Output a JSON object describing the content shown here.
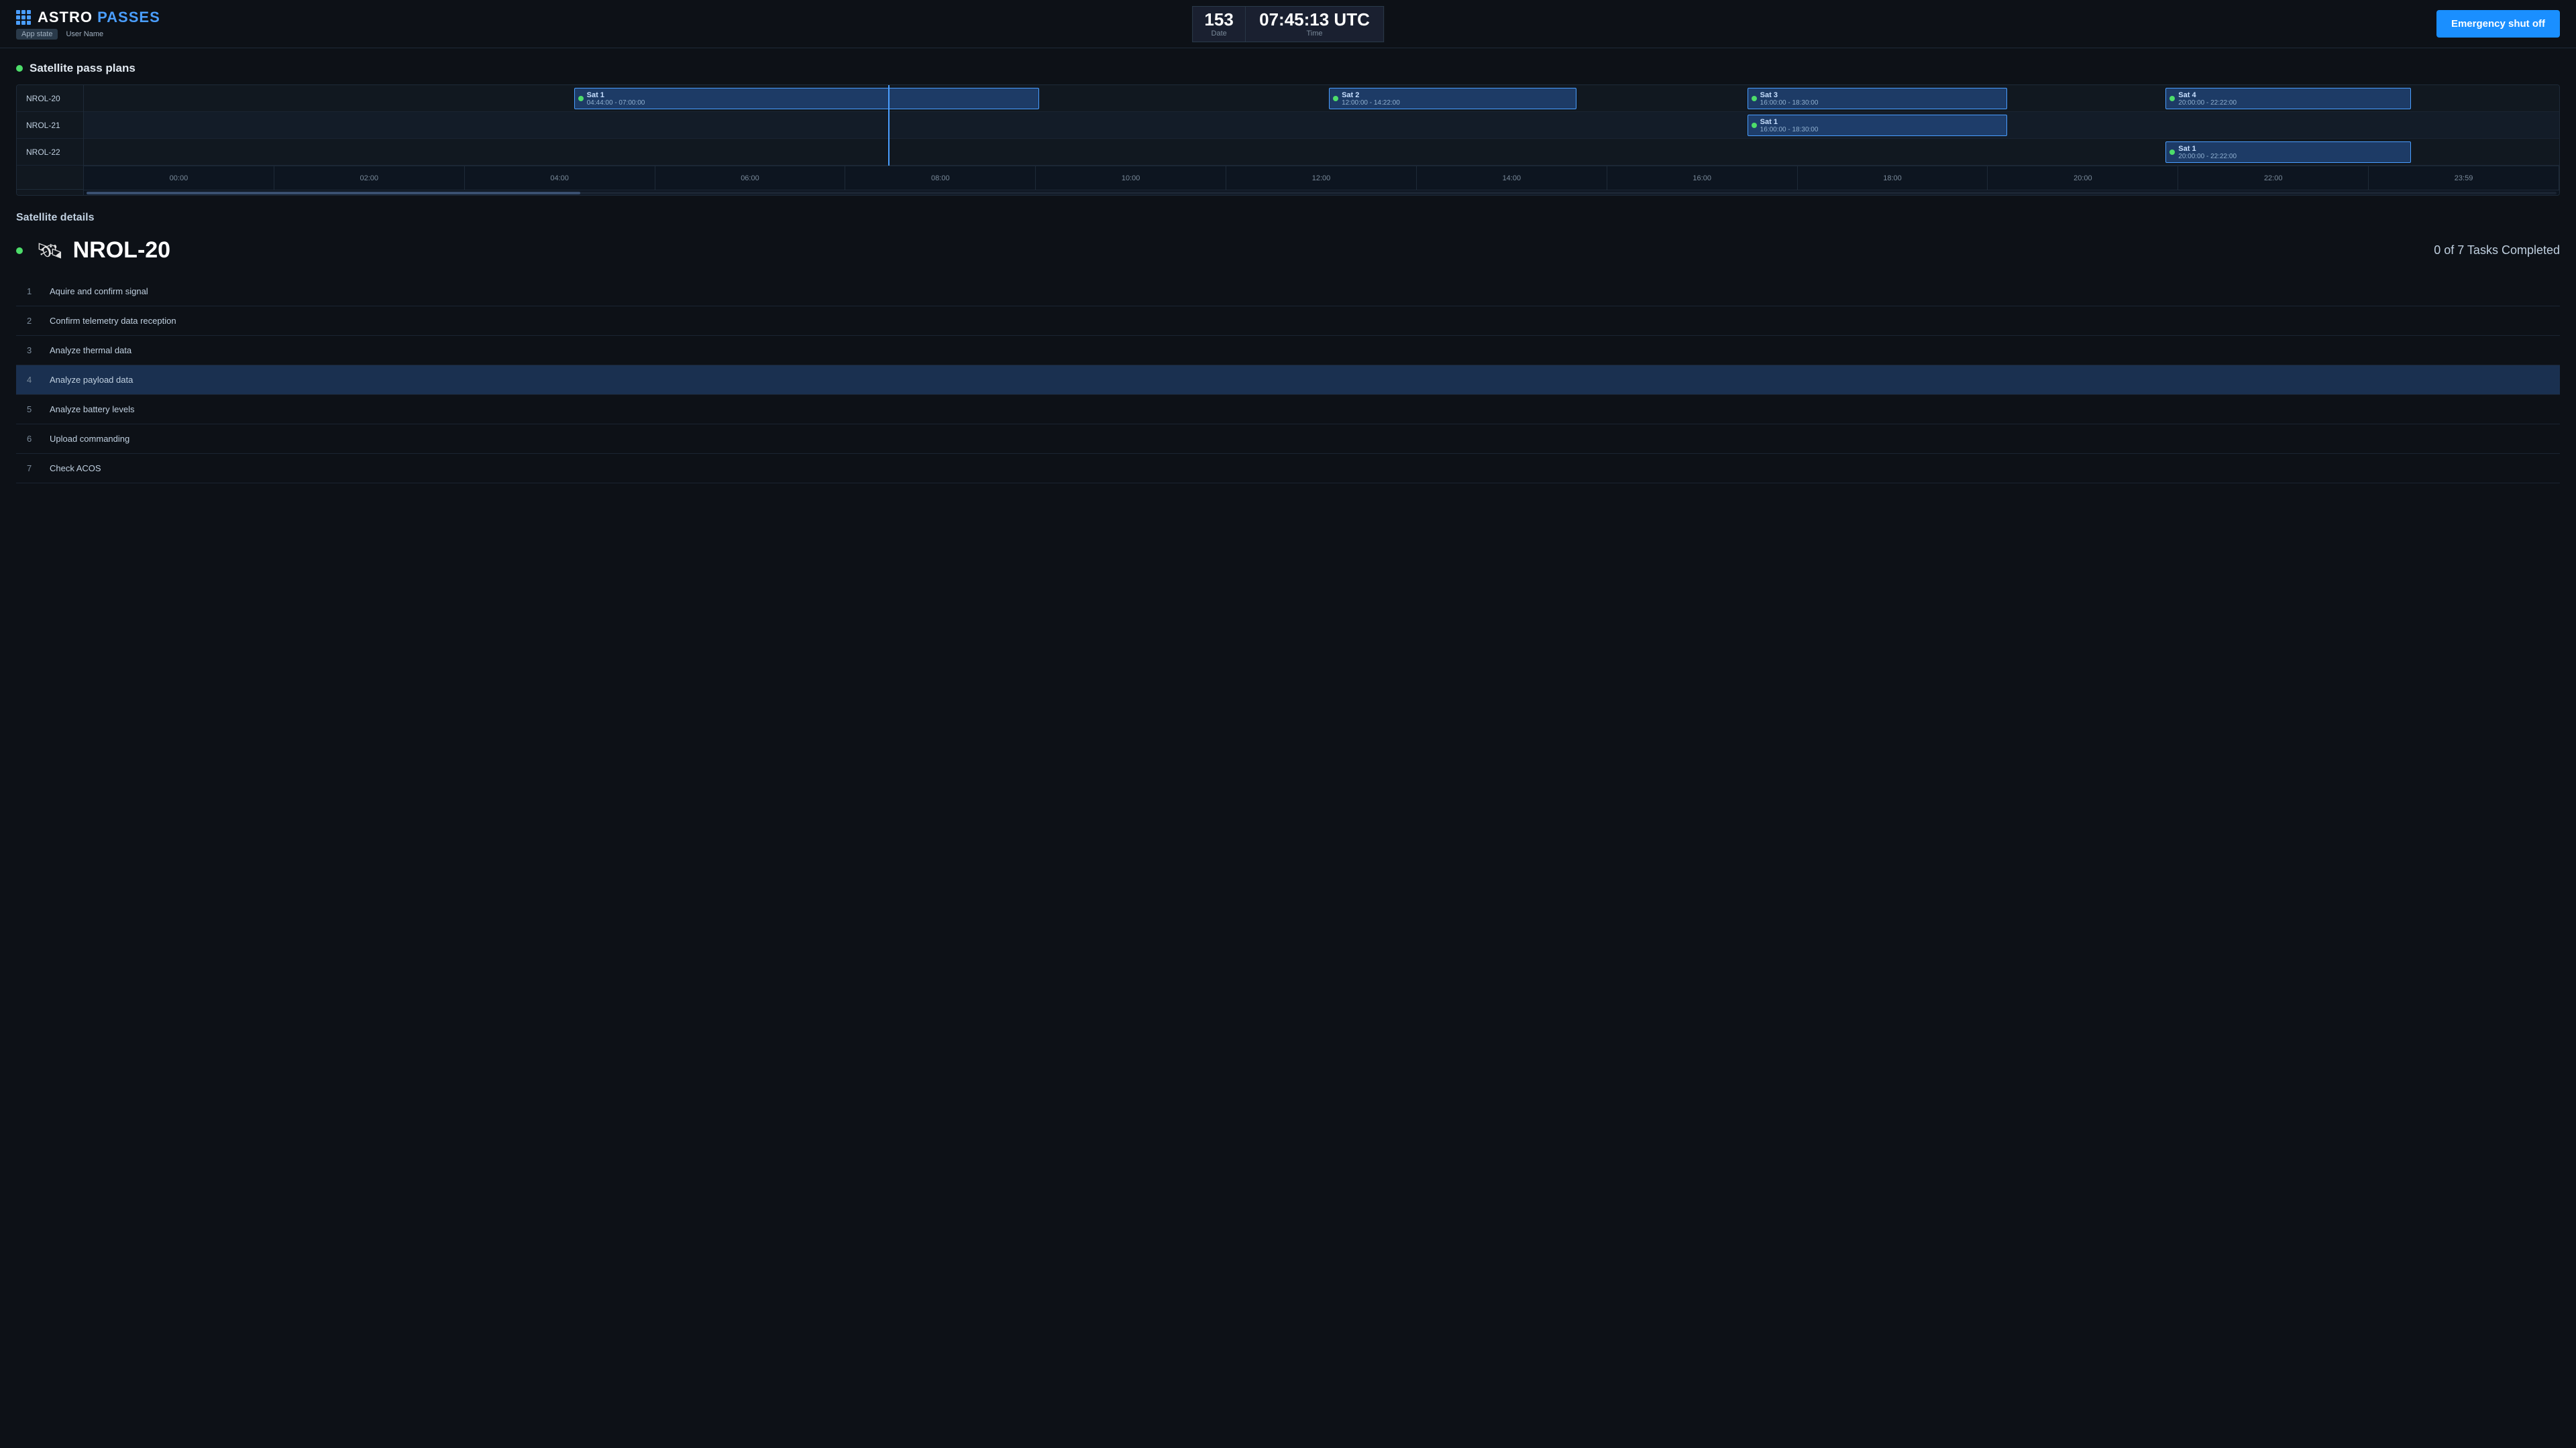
{
  "header": {
    "app_name_bold": "ASTRO",
    "app_name_light": "PASSES",
    "badge_app_state": "App state",
    "badge_user": "User Name",
    "date_label": "Date",
    "date_value": "153",
    "time_label": "Time",
    "time_value": "07:45:13 UTC",
    "emergency_button": "Emergency shut off"
  },
  "satellite_pass_plans": {
    "section_title": "Satellite pass plans",
    "rows": [
      "NROL-20",
      "NROL-21",
      "NROL-22"
    ],
    "timeline_ticks": [
      "00:00",
      "02:00",
      "04:00",
      "06:00",
      "08:00",
      "10:00",
      "12:00",
      "14:00",
      "16:00",
      "18:00",
      "20:00",
      "22:00",
      "23:59"
    ],
    "passes": [
      {
        "row": 0,
        "satellite": "Sat 1",
        "time": "04:44:00 - 07:00:00",
        "start_pct": 19.8,
        "width_pct": 18.8
      },
      {
        "row": 0,
        "satellite": "Sat 2",
        "time": "12:00:00 - 14:22:00",
        "start_pct": 50.3,
        "width_pct": 10.0
      },
      {
        "row": 0,
        "satellite": "Sat 3",
        "time": "16:00:00 - 18:30:00",
        "start_pct": 67.2,
        "width_pct": 10.5
      },
      {
        "row": 0,
        "satellite": "Sat 4",
        "time": "20:00:00 - 22:22:00",
        "start_pct": 84.1,
        "width_pct": 9.9
      },
      {
        "row": 1,
        "satellite": "Sat 1",
        "time": "16:00:00 - 18:30:00",
        "start_pct": 67.2,
        "width_pct": 10.5
      },
      {
        "row": 2,
        "satellite": "Sat 1",
        "time": "20:00:00 - 22:22:00",
        "start_pct": 84.1,
        "width_pct": 9.9
      }
    ],
    "current_time_pct": 32.5
  },
  "satellite_details": {
    "section_title": "Satellite details",
    "satellite_name": "NROL-20",
    "tasks_count_label": "0 of 7 Tasks Completed",
    "tasks": [
      {
        "num": 1,
        "label": "Aquire and confirm signal"
      },
      {
        "num": 2,
        "label": "Confirm telemetry data reception"
      },
      {
        "num": 3,
        "label": "Analyze thermal data"
      },
      {
        "num": 4,
        "label": "Analyze payload data",
        "selected": true
      },
      {
        "num": 5,
        "label": "Analyze battery levels"
      },
      {
        "num": 6,
        "label": "Upload commanding"
      },
      {
        "num": 7,
        "label": "Check ACOS"
      }
    ]
  }
}
